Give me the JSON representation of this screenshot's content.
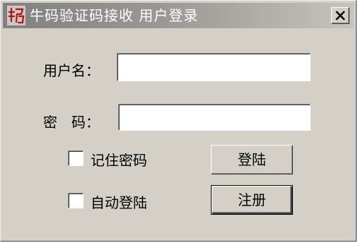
{
  "window": {
    "title": "牛码验证码接收  用户登录",
    "icon": "app-seal-icon",
    "close_icon": "close-icon"
  },
  "form": {
    "username": {
      "label": "用户名：",
      "value": "",
      "placeholder": ""
    },
    "password": {
      "label": "密　码：",
      "value": "",
      "placeholder": ""
    },
    "remember_password": {
      "label": "记住密码",
      "checked": false
    },
    "auto_login": {
      "label": "自动登陆",
      "checked": false
    }
  },
  "buttons": {
    "login": "登陆",
    "register": "注册"
  }
}
